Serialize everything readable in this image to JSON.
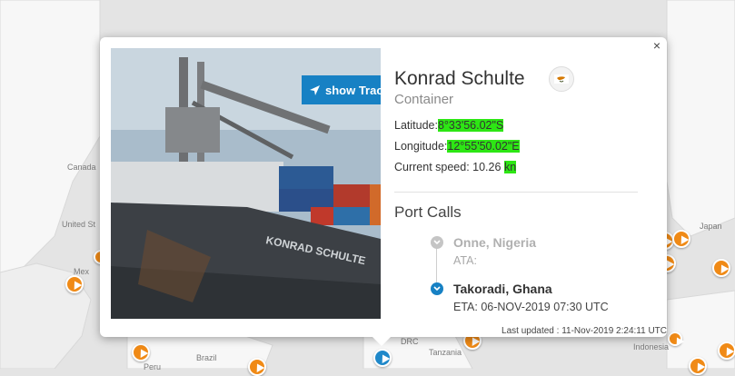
{
  "map": {
    "labels": [
      "Canada",
      "United St",
      "Mex",
      "Brazil",
      "Peru",
      "DRC",
      "Tanzania",
      "Japan",
      "Indonesia"
    ]
  },
  "popup": {
    "close_label": "×",
    "show_track_label": "show Track",
    "ship_name": "Konrad Schulte",
    "ship_type": "Container",
    "flag_icon": "cyprus-flag-icon",
    "latitude_label": "Latitude:",
    "latitude_value": "8°33'56.02\"S",
    "longitude_label": "Longitude:",
    "longitude_value": "12°55'50.02\"E",
    "speed_label": "Current speed: 10.26",
    "speed_unit": "kn",
    "port_calls_title": "Port Calls",
    "port_calls": [
      {
        "name": "Onne, Nigeria",
        "detail": "ATA:",
        "status": "past"
      },
      {
        "name": "Takoradi, Ghana",
        "detail": "ETA: 06-NOV-2019 07:30 UTC",
        "status": "next"
      }
    ],
    "last_updated": "Last updated : 11-Nov-2019 2:24:11 UTC"
  },
  "colors": {
    "accent": "#1781c4",
    "highlight": "#2de614",
    "marker": "#f08a16",
    "past": "#c5c5c5"
  }
}
